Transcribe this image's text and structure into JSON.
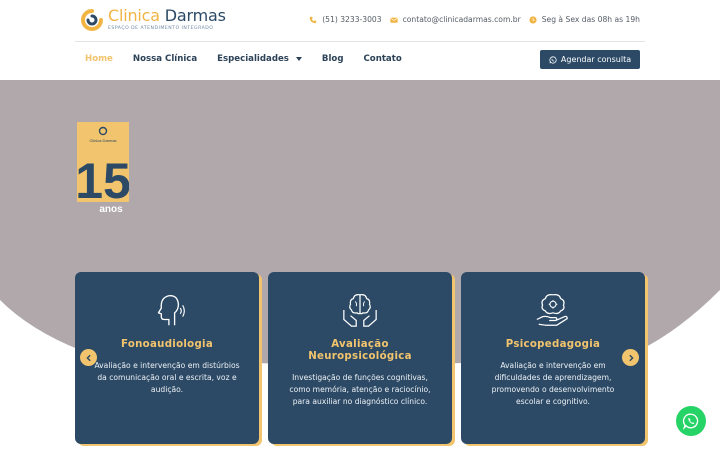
{
  "brand": {
    "name_part1": "Clinica",
    "name_part2": "Darmas",
    "tagline": "ESPAÇO DE ATENDIMENTO INTEGRADO",
    "primary_color": "#2c4a66",
    "accent_color": "#f2c46d"
  },
  "header": {
    "phone": "(51) 3233-3003",
    "email": "contato@clinicadarmas.com.br",
    "hours": "Seg à Sex das 08h as 19h"
  },
  "nav": {
    "items": [
      {
        "label": "Home",
        "icon": null
      },
      {
        "label": "Nossa Clínica",
        "icon": null
      },
      {
        "label": "Especialidades",
        "icon": "caret-down-icon"
      },
      {
        "label": "Blog",
        "icon": null
      },
      {
        "label": "Contato",
        "icon": null
      }
    ],
    "cta_label": "Agendar consulta"
  },
  "hero": {
    "badge_number": "15",
    "badge_word": "anos",
    "badge_brand": "Clinica Darmas",
    "background_color": "#b0a8aa"
  },
  "cards": [
    {
      "title": "Fonoaudiologia",
      "icon": "speaking-head-icon",
      "text": "Avaliação e intervenção em distúrbios da comunicação oral e escrita, voz e audição."
    },
    {
      "title": "Avaliação Neuropsicológica",
      "icon": "brain-hands-icon",
      "text": "Investigação de funções cognitivas, como memória, atenção e raciocínio, para auxiliar no diagnóstico clínico."
    },
    {
      "title": "Psicopedagogia",
      "icon": "brain-gear-hand-icon",
      "text": "Avaliação e intervenção em dificuldades de aprendizagem, promovendo o desenvolvimento escolar e cognitivo."
    }
  ],
  "carousel": {
    "prev_icon": "chevron-left-icon",
    "next_icon": "chevron-right-icon"
  },
  "floating": {
    "icon": "whatsapp-icon",
    "color": "#25d366"
  }
}
